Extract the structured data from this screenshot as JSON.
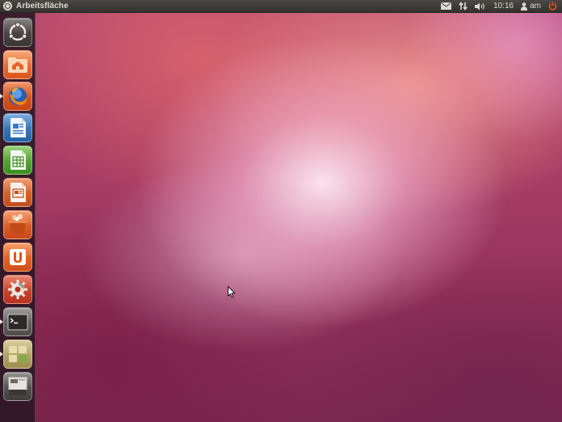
{
  "top_panel": {
    "app_title": "Arbeitsfläche",
    "app_icon": "ubuntu-logo-icon",
    "indicators": {
      "messaging_icon": "envelope-icon",
      "network_icon": "network-arrows-icon",
      "sound_icon": "speaker-icon",
      "clock": "10:16",
      "user_icon": "person-icon",
      "user_name": "am",
      "session_icon": "power-icon",
      "session_color": "#e35a2a"
    }
  },
  "launcher": {
    "items": [
      {
        "name": "Dash",
        "icon": "ubuntu-dash-icon"
      },
      {
        "name": "Persönlicher Ordner",
        "icon": "home-folder-icon"
      },
      {
        "name": "Firefox",
        "icon": "firefox-icon"
      },
      {
        "name": "LibreOffice Writer",
        "icon": "writer-document-icon"
      },
      {
        "name": "LibreOffice Calc",
        "icon": "calc-spreadsheet-icon"
      },
      {
        "name": "LibreOffice Impress",
        "icon": "impress-presentation-icon"
      },
      {
        "name": "Ubuntu Software Center",
        "icon": "software-center-icon"
      },
      {
        "name": "Ubuntu One",
        "icon": "ubuntu-one-icon"
      },
      {
        "name": "Systemeinstellungen",
        "icon": "settings-wrench-icon"
      },
      {
        "name": "Terminal",
        "icon": "terminal-icon"
      },
      {
        "name": "Arbeitsflächenumschalter",
        "icon": "workspace-switcher-icon"
      },
      {
        "name": "Papierkorb",
        "icon": "trash-icon"
      }
    ]
  },
  "desktop": {
    "wallpaper": "ubuntu-default-pink-gradient",
    "accent_colors": [
      "#b5486e",
      "#f6b4d2",
      "#7a2850"
    ]
  },
  "cursor": {
    "icon": "mouse-pointer-icon"
  }
}
